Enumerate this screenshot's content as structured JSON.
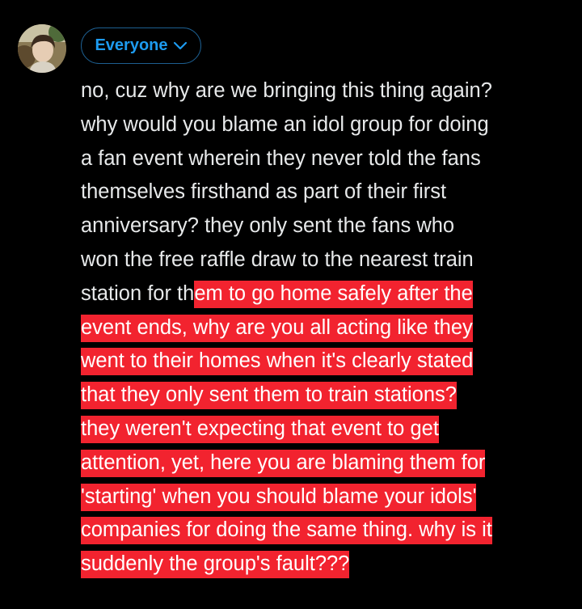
{
  "composer": {
    "audience_label": "Everyone",
    "avatar_icon": "user-avatar-icon",
    "chevron_icon": "chevron-down-icon"
  },
  "tweet": {
    "plain_text": "no, cuz why are we bringing this thing again?\nwhy would you blame an idol group for doing\na fan event wherein they never told the fans\nthemselves firsthand as part of their first\nanniversary? they only sent the fans who\nwon the free raffle draw to the nearest train\nstation for th",
    "highlighted_text": "em to go home safely after the\nevent ends, why are you all acting like they\nwent to their homes when it's clearly stated\nthat they only sent them to train stations?\nthey weren't expecting that event to get\nattention, yet, here you are blaming them for\n'starting' when you should blame your idols'\ncompanies for doing the same thing. why is it\nsuddenly the group's fault???"
  },
  "colors": {
    "background": "#000000",
    "text": "#e7e9ea",
    "accent": "#1d9bf0",
    "highlight": "#f2232f"
  }
}
